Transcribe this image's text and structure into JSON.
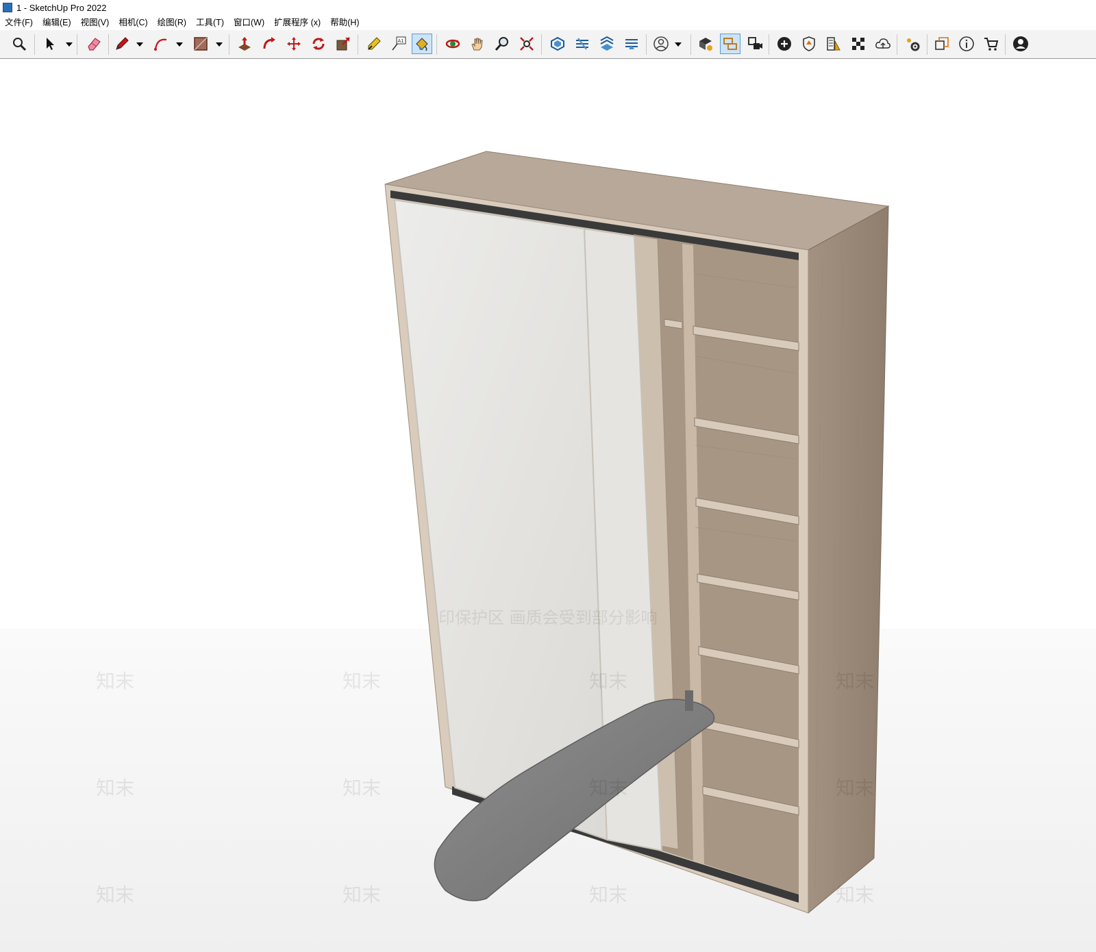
{
  "window": {
    "title": "1 - SketchUp Pro 2022"
  },
  "menu": [
    {
      "id": "file",
      "label": "文件(F)"
    },
    {
      "id": "edit",
      "label": "编辑(E)"
    },
    {
      "id": "view",
      "label": "视图(V)"
    },
    {
      "id": "camera",
      "label": "相机(C)"
    },
    {
      "id": "draw",
      "label": "绘图(R)"
    },
    {
      "id": "tools",
      "label": "工具(T)"
    },
    {
      "id": "window",
      "label": "窗口(W)"
    },
    {
      "id": "extensions",
      "label": "扩展程序 (x)"
    },
    {
      "id": "help",
      "label": "帮助(H)"
    }
  ],
  "toolbar": {
    "active_tools": [
      "paint-bucket-icon",
      "outliner-icon"
    ],
    "icons": [
      "zoom-icon",
      "select-arrow-icon",
      "eraser-icon",
      "pencil-line-icon",
      "arc-icon",
      "rectangle-icon",
      "push-pull-icon",
      "follow-me-icon",
      "move-icon",
      "rotate-icon",
      "scale-icon",
      "tape-measure-icon",
      "text-label-icon",
      "paint-bucket-icon",
      "orbit-icon",
      "pan-hand-icon",
      "zoom-magnifier-icon",
      "zoom-extents-icon",
      "sandbox-from-contours-icon",
      "sandbox-from-scratch-icon",
      "sandbox-smoove-icon",
      "sandbox-stamp-icon",
      "user-account-icon",
      "warehouse-icon",
      "outliner-icon",
      "scenes-icon",
      "add-location-icon",
      "shield-icon",
      "styles-icon",
      "materials-icon",
      "cloud-icon",
      "settings-gears-icon",
      "components-icon",
      "info-icon",
      "cart-icon",
      "profile-icon"
    ]
  },
  "viewport": {
    "watermark_text": "知末",
    "watermark_banner": "印保护区  画质会受到部分影响",
    "colors": {
      "wood": "#b8a99a",
      "wood_dark": "#9c8c7c",
      "mirror": "#e4e2df",
      "trim": "#3a3a3a",
      "ironing_board": "#7e7e7e"
    }
  }
}
